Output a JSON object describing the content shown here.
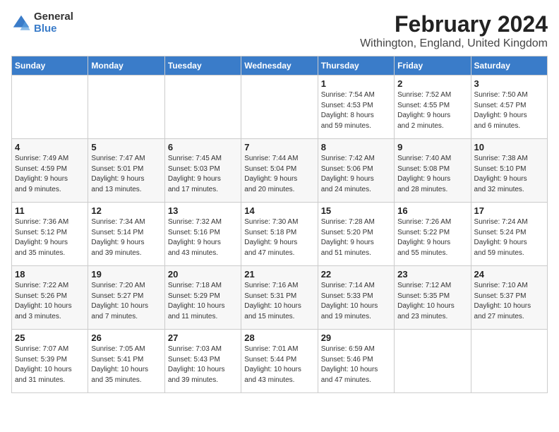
{
  "header": {
    "logo_general": "General",
    "logo_blue": "Blue",
    "title": "February 2024",
    "subtitle": "Withington, England, United Kingdom"
  },
  "weekdays": [
    "Sunday",
    "Monday",
    "Tuesday",
    "Wednesday",
    "Thursday",
    "Friday",
    "Saturday"
  ],
  "weeks": [
    [
      {
        "day": "",
        "info": ""
      },
      {
        "day": "",
        "info": ""
      },
      {
        "day": "",
        "info": ""
      },
      {
        "day": "",
        "info": ""
      },
      {
        "day": "1",
        "info": "Sunrise: 7:54 AM\nSunset: 4:53 PM\nDaylight: 8 hours\nand 59 minutes."
      },
      {
        "day": "2",
        "info": "Sunrise: 7:52 AM\nSunset: 4:55 PM\nDaylight: 9 hours\nand 2 minutes."
      },
      {
        "day": "3",
        "info": "Sunrise: 7:50 AM\nSunset: 4:57 PM\nDaylight: 9 hours\nand 6 minutes."
      }
    ],
    [
      {
        "day": "4",
        "info": "Sunrise: 7:49 AM\nSunset: 4:59 PM\nDaylight: 9 hours\nand 9 minutes."
      },
      {
        "day": "5",
        "info": "Sunrise: 7:47 AM\nSunset: 5:01 PM\nDaylight: 9 hours\nand 13 minutes."
      },
      {
        "day": "6",
        "info": "Sunrise: 7:45 AM\nSunset: 5:03 PM\nDaylight: 9 hours\nand 17 minutes."
      },
      {
        "day": "7",
        "info": "Sunrise: 7:44 AM\nSunset: 5:04 PM\nDaylight: 9 hours\nand 20 minutes."
      },
      {
        "day": "8",
        "info": "Sunrise: 7:42 AM\nSunset: 5:06 PM\nDaylight: 9 hours\nand 24 minutes."
      },
      {
        "day": "9",
        "info": "Sunrise: 7:40 AM\nSunset: 5:08 PM\nDaylight: 9 hours\nand 28 minutes."
      },
      {
        "day": "10",
        "info": "Sunrise: 7:38 AM\nSunset: 5:10 PM\nDaylight: 9 hours\nand 32 minutes."
      }
    ],
    [
      {
        "day": "11",
        "info": "Sunrise: 7:36 AM\nSunset: 5:12 PM\nDaylight: 9 hours\nand 35 minutes."
      },
      {
        "day": "12",
        "info": "Sunrise: 7:34 AM\nSunset: 5:14 PM\nDaylight: 9 hours\nand 39 minutes."
      },
      {
        "day": "13",
        "info": "Sunrise: 7:32 AM\nSunset: 5:16 PM\nDaylight: 9 hours\nand 43 minutes."
      },
      {
        "day": "14",
        "info": "Sunrise: 7:30 AM\nSunset: 5:18 PM\nDaylight: 9 hours\nand 47 minutes."
      },
      {
        "day": "15",
        "info": "Sunrise: 7:28 AM\nSunset: 5:20 PM\nDaylight: 9 hours\nand 51 minutes."
      },
      {
        "day": "16",
        "info": "Sunrise: 7:26 AM\nSunset: 5:22 PM\nDaylight: 9 hours\nand 55 minutes."
      },
      {
        "day": "17",
        "info": "Sunrise: 7:24 AM\nSunset: 5:24 PM\nDaylight: 9 hours\nand 59 minutes."
      }
    ],
    [
      {
        "day": "18",
        "info": "Sunrise: 7:22 AM\nSunset: 5:26 PM\nDaylight: 10 hours\nand 3 minutes."
      },
      {
        "day": "19",
        "info": "Sunrise: 7:20 AM\nSunset: 5:27 PM\nDaylight: 10 hours\nand 7 minutes."
      },
      {
        "day": "20",
        "info": "Sunrise: 7:18 AM\nSunset: 5:29 PM\nDaylight: 10 hours\nand 11 minutes."
      },
      {
        "day": "21",
        "info": "Sunrise: 7:16 AM\nSunset: 5:31 PM\nDaylight: 10 hours\nand 15 minutes."
      },
      {
        "day": "22",
        "info": "Sunrise: 7:14 AM\nSunset: 5:33 PM\nDaylight: 10 hours\nand 19 minutes."
      },
      {
        "day": "23",
        "info": "Sunrise: 7:12 AM\nSunset: 5:35 PM\nDaylight: 10 hours\nand 23 minutes."
      },
      {
        "day": "24",
        "info": "Sunrise: 7:10 AM\nSunset: 5:37 PM\nDaylight: 10 hours\nand 27 minutes."
      }
    ],
    [
      {
        "day": "25",
        "info": "Sunrise: 7:07 AM\nSunset: 5:39 PM\nDaylight: 10 hours\nand 31 minutes."
      },
      {
        "day": "26",
        "info": "Sunrise: 7:05 AM\nSunset: 5:41 PM\nDaylight: 10 hours\nand 35 minutes."
      },
      {
        "day": "27",
        "info": "Sunrise: 7:03 AM\nSunset: 5:43 PM\nDaylight: 10 hours\nand 39 minutes."
      },
      {
        "day": "28",
        "info": "Sunrise: 7:01 AM\nSunset: 5:44 PM\nDaylight: 10 hours\nand 43 minutes."
      },
      {
        "day": "29",
        "info": "Sunrise: 6:59 AM\nSunset: 5:46 PM\nDaylight: 10 hours\nand 47 minutes."
      },
      {
        "day": "",
        "info": ""
      },
      {
        "day": "",
        "info": ""
      }
    ]
  ]
}
